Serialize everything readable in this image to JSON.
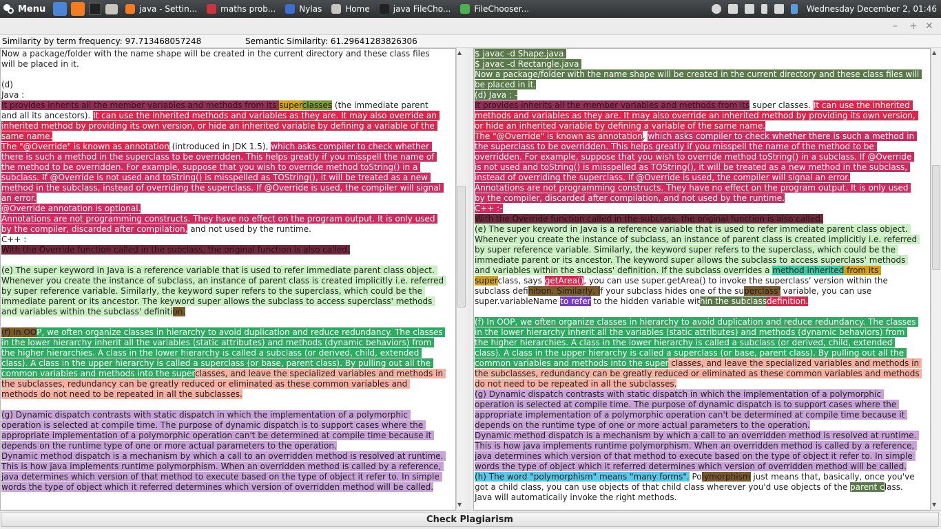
{
  "panel": {
    "menu_label": "Menu",
    "tasks": [
      {
        "label": "java - Settin...",
        "color": "#f47b20"
      },
      {
        "label": "maths prob...",
        "color": "#c9353f"
      },
      {
        "label": "Nylas",
        "color": "#3a6fd0"
      },
      {
        "label": "Home",
        "color": "#c9c6c0"
      },
      {
        "label": "java FileCho...",
        "color": "#222222"
      },
      {
        "label": "FileChooser...",
        "color": "#4caf50"
      }
    ],
    "clock": "Wednesday December  2, 01:46"
  },
  "window": {
    "controls": [
      "–",
      "+",
      "✕"
    ]
  },
  "similarity": {
    "term_frequency": "Similarity by term frequency: 97.713468057248",
    "semantic": "Semantic Similarity: 61.29641283826306"
  },
  "left_text": [
    [
      [
        "",
        "Now a package/folder with the name shape will be created in the current directory and these class files will be placed in it.\n\n(d)\nJava :\n"
      ]
    ],
    [
      [
        "h-plum",
        "It provides inherits all the member variables and methods from its "
      ],
      [
        "h-gold",
        "super"
      ],
      [
        "h-olive",
        "classes"
      ],
      [
        "",
        " (the immediate parent and all its ancestors). "
      ],
      [
        "h-red",
        "It can use the inherited methods and variables as they are. It may also override an inherited method by providing its own version, or hide an inherited variable by defining a variable of the same name."
      ],
      [
        "",
        "\n"
      ],
      [
        "h-red",
        "The \"@Override\" is known as annotation"
      ],
      [
        "",
        " (introduced in JDK 1.5), "
      ],
      [
        "h-rose",
        "which asks compiler to check whether there is such a method in the superclass to be overridden. This helps greatly if you misspell the name of the method to be overridden. For example, suppose that you wish to override method toString() in a subclass. If @Override is not used and toString() is misspelled as TOString(), it will be treated as a new method in the subclass, instead of overriding the superclass. If @Override is used, the compiler will signal an error."
      ],
      [
        "",
        "\n"
      ],
      [
        "h-rose",
        "@Override annotation is optional."
      ],
      [
        "",
        "\n"
      ],
      [
        "h-rose",
        "Annotations are not programming constructs. They have no effect on the program output. It is only used by the compiler, discarded after compilation,"
      ],
      [
        "",
        " and not used by the runtime.\nC++ :\n"
      ],
      [
        "h-wine",
        "With the Override function called in the subclass, the original function is also called."
      ],
      [
        "",
        "\n\n"
      ]
    ],
    [
      [
        "h-lgreen",
        "(e) The super keyword in Java is a reference variable that is used to refer immediate parent class object. Whenever you create the instance of subclass, an instance of parent class is created implicitly i.e. referred by super reference variable. Similarly, the keyword super refers to the superclass, which could be the immediate parent or its ancestor. The keyword super allows the subclass to access superclass' methods and variables within the subclass' definiti"
      ],
      [
        "h-brown",
        "on."
      ],
      [
        "",
        "\n\n"
      ]
    ],
    [
      [
        "h-brown",
        "(f) In OO"
      ],
      [
        "h-green",
        "P, we often organize classes in hierarchy to avoid duplication and reduce redundancy. The classes in the lower hierarchy inherit all the variables (static attributes) and methods (dynamic behaviors) from the higher hierarchies. A class in the lower hierarchy is called a subclass (or derived, child, extended class). A class in the upper hierarchy is called a superclass (or base, parent class). By pulling out all the common variables and methods into the super"
      ],
      [
        "h-salmon",
        "classes, and leave the specialized variables and methods in the subclasses, redundancy can be greatly reduced or eliminated as these common variables and methods do not need to be repeated in all the subclasses."
      ],
      [
        "",
        "\n\n"
      ]
    ],
    [
      [
        "h-lav",
        "(g) Dynamic dispatch contrasts with static dispatch in which the implementation of a polymorphic operation is selected at compile time. The purpose of dynamic dispatch is to support cases where the appropriate implementation of a polymorphic operation can't be determined at compile time because it depends on the runtime type of one or more actual parameters to the operation."
      ],
      [
        "",
        "\n"
      ],
      [
        "h-lav",
        "Dynamic method dispatch is a mechanism by which a call to an overridden method is resolved at runtime. This is how java implements runtime polymorphism. When an overridden method is called by a reference, java determines which version of that method to execute based on the type of object it refer to. In simple words the type of object which it referred determines which version of overridden method will be called."
      ]
    ]
  ],
  "right_text": [
    [
      [
        "h-sage",
        "$ javac -d Shape.java "
      ],
      [
        "",
        "\n"
      ],
      [
        "h-sage",
        "$ javac -d Rectangle.java "
      ],
      [
        "",
        "\n"
      ],
      [
        "h-sage",
        "Now a package/folder with the name shape will be created in the current directory and these class files will be placed in it."
      ],
      [
        "",
        "\n"
      ],
      [
        "h-sage",
        "(d) Java : -"
      ],
      [
        "",
        "\n"
      ]
    ],
    [
      [
        "h-plum",
        "It provides inherits all the member variables and methods from its"
      ],
      [
        "",
        " super classes. "
      ],
      [
        "h-red",
        "It can use the inherited methods and variables as they are. It may also override an inherited method by providing its own version, or hide an inherited variable by defining a variable of the same name."
      ],
      [
        "",
        "\n"
      ],
      [
        "h-red",
        "The \"@Override\" is known as annotation"
      ],
      [
        "",
        ", "
      ],
      [
        "h-rose",
        "which asks compiler to check whether there is such a method in the superclass to be overridden. This helps greatly if you misspell the name of the method to be overridden. For example, suppose that you wish to override method toString() in a subclass. If @Override is not used and toString() is misspelled as TOString(), it will be treated as a new method in the subclass, instead of overriding the superclass. If @Override is used, the compiler will signal an error."
      ],
      [
        "",
        "\n"
      ],
      [
        "h-rose",
        "Annotations are not programming constructs. They have no effect on the program output. It is only used by the compiler, discarded after compilation, and not used by the runtime."
      ],
      [
        "",
        "\n"
      ],
      [
        "h-rose",
        "C++ :-"
      ],
      [
        "",
        "\n"
      ],
      [
        "h-wine",
        "With the Override function called in the subclass, the original function is also called."
      ],
      [
        "",
        "\n"
      ]
    ],
    [
      [
        "h-lgreen",
        "(e) The super keyword in Java is a reference variable that is used to refer immediate parent class object. Whenever you create the instance of subclass, an instance of parent class is created implicitly i.e. referred by super reference variable. Similarly, the keyword super refers to the superclass, which could be the immediate parent or its ancestor. The keyword super allows the subclass to access superclass' methods and variables within the subclass' definition. If the subclass overrides a "
      ],
      [
        "h-teal",
        "method inherited"
      ],
      [
        "h-gold",
        " from its super"
      ],
      [
        "",
        "class, says "
      ],
      [
        "h-red",
        "getArea()"
      ],
      [
        "",
        ", you can use super.getArea() to invoke the superclass' version within the subclass def"
      ],
      [
        "h-brown",
        "inition. Similarly, i"
      ],
      [
        "",
        "f your subclass hides one of the su"
      ],
      [
        "h-brown",
        "perclass'"
      ],
      [
        "",
        " variable, you can use super.variableName "
      ],
      [
        "h-purple",
        "to refer"
      ],
      [
        "",
        " to the hidden variable wit"
      ],
      [
        "h-sage",
        "hin the subclass"
      ],
      [
        " ",
        ""
      ],
      [
        "h-red",
        "definition."
      ],
      [
        "",
        "\n\n"
      ]
    ],
    [
      [
        "h-green",
        "(f) In OOP, we often organize classes in hierarchy to avoid duplication and reduce redundancy. The classes in the lower hierarchy inherit all the variables (static attributes) and methods (dynamic behaviors) from the higher hierarchies. A class in the lower hierarchy is called a subclass (or derived, child, extended class). A class in the upper hierarchy is called a superclass (or base, parent class). By pulling out all the common variables and methods into the super"
      ],
      [
        "h-salmon",
        " classes, and leave the specialized variables and methods in the subclasses, redundancy can be greatly reduced or eliminated as these common variables and methods do not need to be repeated in all the subclasses."
      ],
      [
        "",
        "\n"
      ]
    ],
    [
      [
        "h-lav",
        "(g) Dynamic dispatch contrasts with static dispatch in which the implementation of a polymorphic operation is selected at compile time. The purpose of dynamic dispatch is to support cases where the appropriate implementation of a polymorphic operation can't be determined at compile time because it depends on the runtime type of one or more actual parameters to the operation."
      ],
      [
        "",
        "\n"
      ],
      [
        "h-lav",
        "Dynamic method dispatch is a mechanism by which a call to an overridden method is resolved at runtime. This is how java implements runtime polymorphism. When an overridden method is called by a reference, java determines which version of that method to execute based on the type of object it refer to. In simple words the type of object which it referred determines which version of overridden method will be called."
      ],
      [
        "",
        "\n"
      ],
      [
        "h-cyan",
        "(h) The word \"polymorphism\" means \"many forms\"."
      ],
      [
        "",
        " Po"
      ],
      [
        "h-brown",
        "lymorphism"
      ],
      [
        "",
        " just means that, basically, once you've got a child class, you can use objects of that child class wherever you'd use objects of the "
      ],
      [
        "h-sage",
        "parent c"
      ],
      [
        "",
        "lass. Java will automatically invoke the right methods."
      ]
    ]
  ],
  "check_button": "Check Plagiarism"
}
